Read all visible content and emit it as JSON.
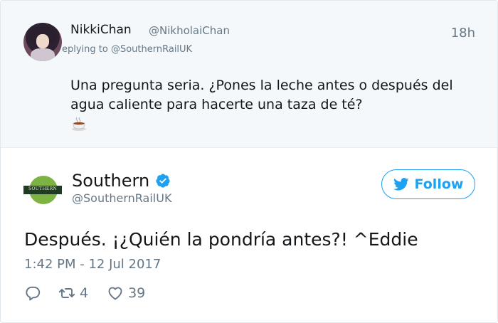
{
  "reply": {
    "name": "NikkiChan",
    "handle": "@NikholaiChan",
    "time": "18h",
    "replying_to": "eplying to @SouthernRailUK",
    "text": "Una pregunta seria. ¿Pones la leche antes o después del agua caliente para hacerte una taza de té?",
    "emoji_icon": "hot-tea-icon"
  },
  "tweet": {
    "name": "Southern",
    "verified_icon": "verified-badge-icon",
    "handle": "@SouthernRailUK",
    "logo_text": "SOUTHERN",
    "follow_label": "Follow",
    "text": "Después. ¡¿Quién la pondría antes?! ^Eddie",
    "timestamp": "1:42 PM - 12 Jul 2017",
    "retweets": "4",
    "likes": "39"
  },
  "colors": {
    "accent": "#1da1f2",
    "muted_text": "#657786",
    "reply_background": "#f5f8fa",
    "logo_green": "#7cb342",
    "logo_band": "#1f3b22"
  }
}
